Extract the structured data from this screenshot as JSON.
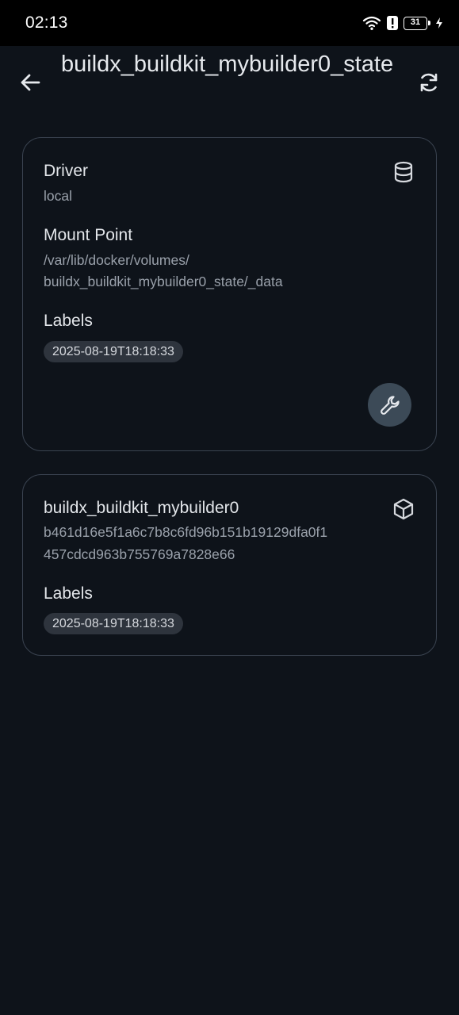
{
  "status_bar": {
    "time": "02:13",
    "battery": "31",
    "icons": [
      "wifi-icon",
      "alert-icon",
      "battery-icon",
      "charging-icon"
    ]
  },
  "app_bar": {
    "title": "buildx_buildkit_mybuilder0_state",
    "back_icon": "arrow-back-icon",
    "refresh_icon": "refresh-icon"
  },
  "volume_card": {
    "driver_label": "Driver",
    "driver_value": "local",
    "driver_icon": "database-icon",
    "mount_label": "Mount Point",
    "mount_value_line1": "/var/lib/docker/volumes/",
    "mount_value_line2": "buildx_buildkit_mybuilder0_state/_data",
    "labels_label": "Labels",
    "label_chip": "2025-08-19T18:18:33",
    "action_icon": "wrench-icon"
  },
  "container_card": {
    "name": "buildx_buildkit_mybuilder0",
    "id_line1": "b461d16e5f1a6c7b8c6fd96b151b19129dfa0f1",
    "id_line2": "457cdcd963b755769a7828e66",
    "container_icon": "cube-icon",
    "labels_label": "Labels",
    "label_chip": "2025-08-19T18:18:33"
  },
  "colors": {
    "background": "#0e131a",
    "card_border": "#3a4350",
    "chip_bg": "#2e343d",
    "fab_bg": "#3c4a57"
  }
}
